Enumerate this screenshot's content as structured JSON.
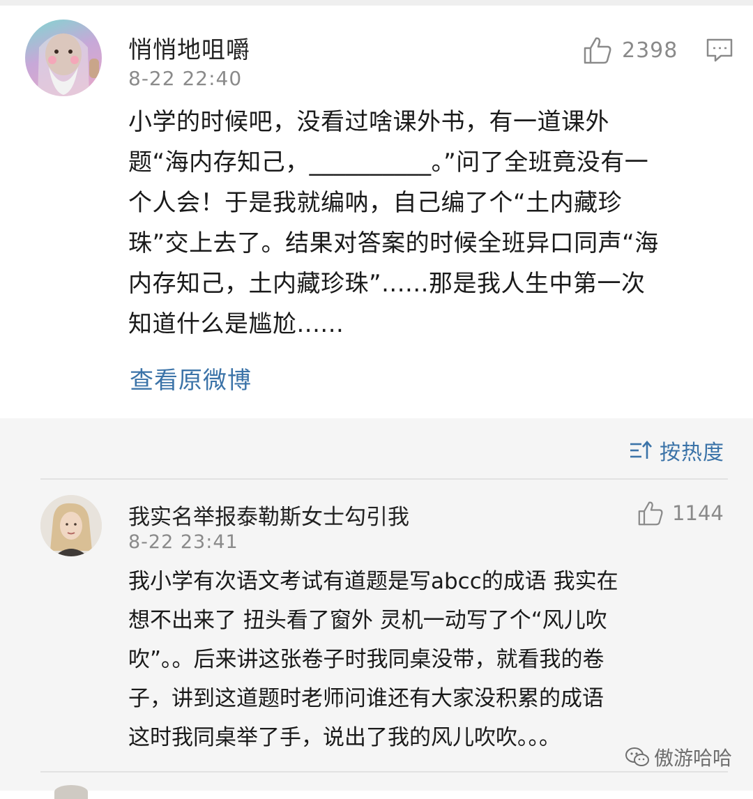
{
  "post": {
    "username": "悄悄地咀嚼",
    "time": "8-22 22:40",
    "like_count": "2398",
    "body": "小学的时候吧，没看过啥课外书，有一道课外\n题“海内存知己，__________。”问了全班竟没有一\n个人会！于是我就编呐，自己编了个“土内藏珍\n珠”交上去了。结果对答案的时候全班异口同声“海\n内存知己，土内藏珍珠”......那是我人生中第一次\n知道什么是尴尬......",
    "view_original": "查看原微博"
  },
  "comments_section": {
    "sort_label": "按热度"
  },
  "comment": {
    "username": "我实名举报泰勒斯女士勾引我",
    "time": "8-22 23:41",
    "like_count": "1144",
    "body": "我小学有次语文考试有道题是写abcc的成语 我实在\n想不出来了 扭头看了窗外 灵机一动写了个“风儿吹\n吹”。。后来讲这张卷子时我同桌没带，就看我的卷\n子，讲到这道题时老师问谁还有大家没积累的成语\n这时我同桌举了手，说出了我的风儿吹吹。。。"
  },
  "watermark": {
    "text": "傲游哈哈"
  },
  "icons": {
    "like": "thumbs-up-icon",
    "comment": "comment-bubble-icon",
    "sort": "sort-icon",
    "wechat": "wechat-icon"
  },
  "colors": {
    "link": "#3b73a8",
    "meta": "#8a8a8a",
    "band": "#f5f5f5"
  }
}
